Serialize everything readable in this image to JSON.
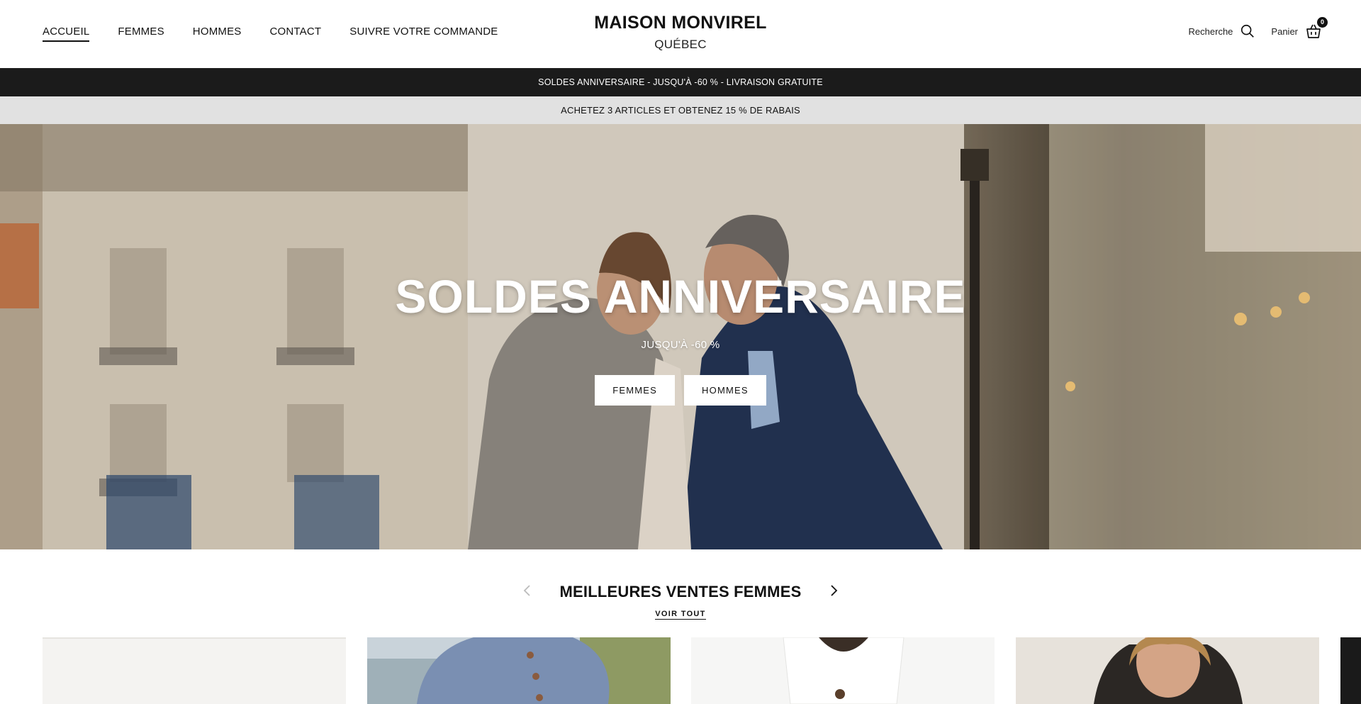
{
  "header": {
    "nav": [
      {
        "label": "ACCUEIL",
        "active": true
      },
      {
        "label": "FEMMES"
      },
      {
        "label": "HOMMES"
      },
      {
        "label": "CONTACT"
      },
      {
        "label": "SUIVRE VOTRE COMMANDE"
      }
    ],
    "brand_name": "MAISON MONVIREL",
    "brand_sub": "QUÉBEC",
    "search_label": "Recherche",
    "cart_label": "Panier",
    "cart_count": "0",
    "icons": {
      "search": "search-icon",
      "cart": "basket-icon"
    }
  },
  "announcements": {
    "primary": "SOLDES ANNIVERSAIRE - JUSQU'À -60 % - LIVRAISON GRATUITE",
    "secondary": "ACHETEZ 3 ARTICLES ET OBTENEZ 15 % DE RABAIS"
  },
  "hero": {
    "title": "SOLDES ANNIVERSAIRE",
    "subtitle": "JUSQU'À -60 %",
    "buttons": [
      "FEMMES",
      "HOMMES"
    ]
  },
  "bestsellers": {
    "title": "MEILLEURES VENTES FEMMES",
    "link": "VOIR TOUT",
    "prev_disabled": true
  },
  "colors": {
    "announcement_dark": "#1b1b1b",
    "announcement_light": "#e1e1e1",
    "text": "#111111"
  }
}
